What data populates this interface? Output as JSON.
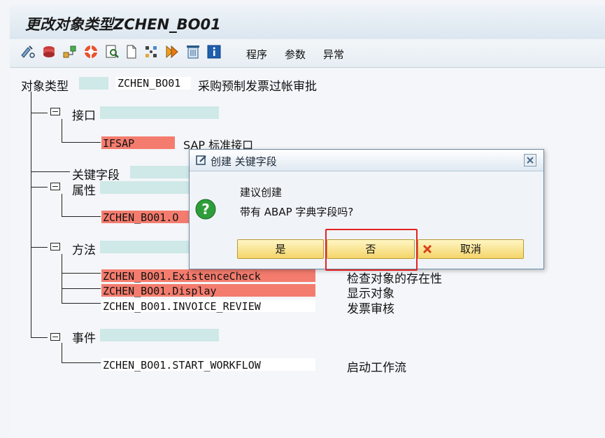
{
  "window": {
    "title": "更改对象类型ZCHEN_BO01"
  },
  "toolbar": {
    "menus": [
      "程序",
      "参数",
      "异常"
    ]
  },
  "object": {
    "label": "对象类型",
    "name": "ZCHEN_BO01",
    "description": "采购预制发票过帐审批"
  },
  "tree": {
    "interfaces": {
      "label": "接口",
      "items": [
        {
          "name": "IFSAP",
          "desc": "SAP 标准接口"
        }
      ]
    },
    "key_fields": {
      "label": "关键字段"
    },
    "attributes": {
      "label": "属性",
      "items": [
        {
          "name": "ZCHEN_BO01.O"
        }
      ]
    },
    "methods": {
      "label": "方法",
      "items": [
        {
          "name": "ZCHEN_BO01.ExistenceCheck",
          "desc": "检查对象的存在性"
        },
        {
          "name": "ZCHEN_BO01.Display",
          "desc": "显示对象"
        },
        {
          "name": "ZCHEN_BO01.INVOICE_REVIEW",
          "desc": "发票审核"
        }
      ]
    },
    "events": {
      "label": "事件",
      "items": [
        {
          "name": "ZCHEN_BO01.START_WORKFLOW",
          "desc": "启动工作流"
        }
      ]
    }
  },
  "dialog": {
    "title": "创建 关键字段",
    "line1": "建议创建",
    "line2": "带有 ABAP 字典字段吗?",
    "yes": "是",
    "no": "否",
    "cancel": "取消"
  },
  "colors": {
    "accent_red": "#f47c6e",
    "field_cyan": "#cfe8e8",
    "highlight": "#e52222"
  }
}
